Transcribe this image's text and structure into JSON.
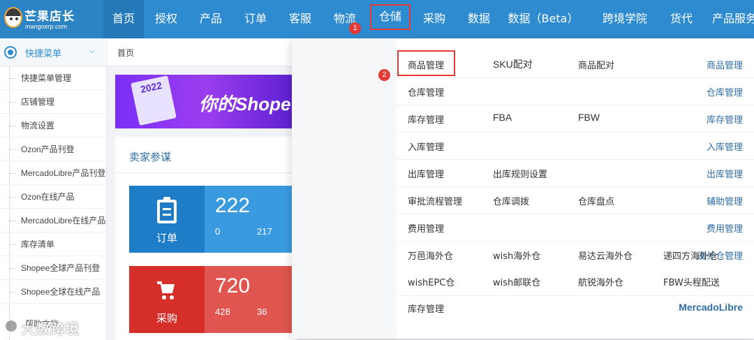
{
  "logo": {
    "title": "芒果店长",
    "subtitle": "mangoerp.com"
  },
  "nav": {
    "items": [
      {
        "label": "首页"
      },
      {
        "label": "授权"
      },
      {
        "label": "产品"
      },
      {
        "label": "订单"
      },
      {
        "label": "客服"
      },
      {
        "label": "物流"
      },
      {
        "label": "仓储"
      },
      {
        "label": "采购"
      },
      {
        "label": "数据"
      },
      {
        "label": "数据（Beta）"
      },
      {
        "label": "跨境学院"
      },
      {
        "label": "货代"
      },
      {
        "label": "产品服务"
      }
    ],
    "active": "仓储",
    "step1": "1",
    "step2": "2"
  },
  "sidebar": {
    "header": "快捷菜单",
    "items": [
      {
        "label": "快捷菜单管理"
      },
      {
        "label": "店铺管理"
      },
      {
        "label": "物流设置"
      },
      {
        "label": "Ozon产品刊登"
      },
      {
        "label": "MercadoLibre产品刊登"
      },
      {
        "label": "Ozon在线产品"
      },
      {
        "label": "MercadoLibre在线产品"
      },
      {
        "label": "库存清单"
      },
      {
        "label": "Shopee全球产品刊登"
      },
      {
        "label": "Shopee全球在线产品"
      }
    ]
  },
  "main": {
    "breadcrumb": "首页",
    "banner": {
      "year": "2022",
      "slogan": "你的Shope"
    },
    "panel_title": "卖家参谋",
    "stats": [
      {
        "label": "订单",
        "total": "222",
        "sub1": "0",
        "sub2": "217",
        "color": "#2e8bd0",
        "num_color": "#3a9ae0"
      },
      {
        "label": "采购",
        "total": "720",
        "sub1": "428",
        "sub2": "36",
        "color": "#d93a35",
        "num_color": "#e05550"
      }
    ]
  },
  "dropdown": {
    "categories": [
      {
        "label": "商品管理",
        "links": [
          "商品管理",
          "SKU配对",
          "商品配对"
        ]
      },
      {
        "label": "仓库管理",
        "links": [
          "仓库管理"
        ]
      },
      {
        "label": "库存管理",
        "links": [
          "库存管理",
          "FBA",
          "FBW"
        ]
      },
      {
        "label": "入库管理",
        "links": [
          "入库管理"
        ]
      },
      {
        "label": "出库管理",
        "links": [
          "出库管理",
          "出库规则设置"
        ]
      },
      {
        "label": "辅助管理",
        "links": [
          "审批流程管理",
          "仓库调拨",
          "仓库盘点"
        ]
      },
      {
        "label": "费用管理",
        "links": [
          "费用管理"
        ]
      },
      {
        "label": "海外仓管理",
        "links": [
          "万邑海外仓",
          "wish海外仓",
          "易达云海外仓",
          "递四方海外仓",
          "wishEPC仓",
          "wish邮联仓",
          "航锐海外仓",
          "FBW头程配送"
        ]
      },
      {
        "label": "MercadoLibre",
        "links": [
          "库存管理"
        ]
      }
    ]
  },
  "footer": {
    "help": "帮助文档",
    "watermark": "大数跨境"
  },
  "colors": {
    "nav_bg": "#2e8bd0",
    "accent": "#2e6da4",
    "highlight": "#e53935"
  }
}
